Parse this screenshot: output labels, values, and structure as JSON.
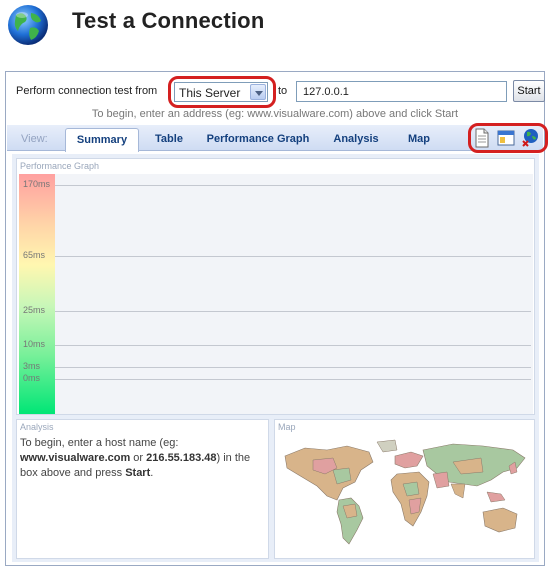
{
  "header": {
    "title": "Test a Connection",
    "icon": "globe-icon"
  },
  "toolbar": {
    "from_label": "Perform connection test from",
    "server_value": "This Server",
    "to_label": "to",
    "address_value": "127.0.0.1",
    "start_label": "Start",
    "hint": "To begin, enter an address (eg: www.visualware.com) above and click Start"
  },
  "tabs": {
    "view_label": "View:",
    "items": [
      {
        "label": "Summary",
        "active": true
      },
      {
        "label": "Table",
        "active": false
      },
      {
        "label": "Performance Graph",
        "active": false
      },
      {
        "label": "Analysis",
        "active": false
      },
      {
        "label": "Map",
        "active": false
      }
    ],
    "icons": [
      "document-icon",
      "window-icon",
      "globe-close-icon"
    ]
  },
  "graph": {
    "title": "Performance Graph",
    "ticks": [
      "170ms",
      "65ms",
      "25ms",
      "10ms",
      "3ms",
      "0ms"
    ]
  },
  "analysis": {
    "title": "Analysis",
    "text_1": "To begin, enter a host name (eg:",
    "host_example": "www.visualware.com",
    "text_or": " or ",
    "ip_example": "216.55.183.48",
    "text_2": ") in the box above and press ",
    "start_word": "Start",
    "text_end": "."
  },
  "map": {
    "title": "Map"
  },
  "colors": {
    "highlight": "#d42020",
    "tab_text": "#14407e",
    "scale_top": "#ffa0a0",
    "scale_bottom": "#00e676"
  }
}
